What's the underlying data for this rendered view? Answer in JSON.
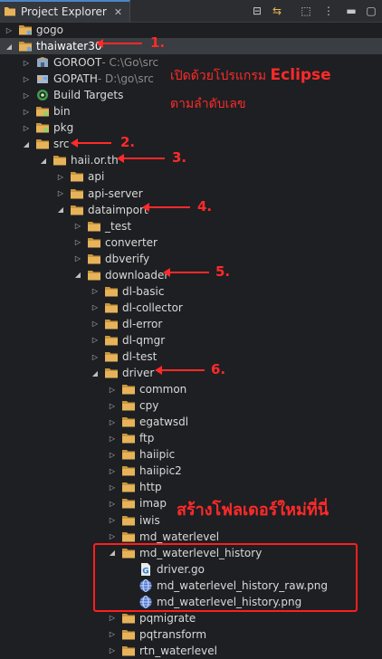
{
  "panel": {
    "tab_title": "Project Explorer",
    "close_glyph": "✕"
  },
  "toolbar": [
    {
      "name": "collapse-all-icon",
      "glyph": "⊟"
    },
    {
      "name": "link-with-editor-icon",
      "glyph": "⇆"
    },
    {
      "name": "focus-icon",
      "glyph": "⬚"
    },
    {
      "name": "view-menu-icon",
      "glyph": "⋮"
    },
    {
      "name": "minimize-icon",
      "glyph": "▬"
    },
    {
      "name": "maximize-icon",
      "glyph": "▢"
    }
  ],
  "tree": [
    {
      "label": "gogo",
      "depth": 0,
      "exp": false,
      "icon": "project-closed"
    },
    {
      "label": "thaiwater30",
      "depth": 0,
      "exp": true,
      "icon": "project",
      "sel": true
    },
    {
      "label": "GOROOT",
      "suffix": " - C:\\Go\\src",
      "depth": 1,
      "exp": false,
      "icon": "goroot"
    },
    {
      "label": "GOPATH",
      "suffix": " - D:\\go\\src",
      "depth": 1,
      "exp": false,
      "icon": "gopath"
    },
    {
      "label": "Build Targets",
      "depth": 1,
      "exp": false,
      "icon": "build"
    },
    {
      "label": "bin",
      "depth": 1,
      "exp": false,
      "icon": "folder-special"
    },
    {
      "label": "pkg",
      "depth": 1,
      "exp": false,
      "icon": "folder-special"
    },
    {
      "label": "src",
      "depth": 1,
      "exp": true,
      "icon": "folder"
    },
    {
      "label": "haii.or.th",
      "depth": 2,
      "exp": true,
      "icon": "folder"
    },
    {
      "label": "api",
      "depth": 3,
      "exp": false,
      "icon": "folder"
    },
    {
      "label": "api-server",
      "depth": 3,
      "exp": false,
      "icon": "folder"
    },
    {
      "label": "dataimport",
      "depth": 3,
      "exp": true,
      "icon": "folder"
    },
    {
      "label": "_test",
      "depth": 4,
      "exp": false,
      "icon": "folder"
    },
    {
      "label": "converter",
      "depth": 4,
      "exp": false,
      "icon": "folder"
    },
    {
      "label": "dbverify",
      "depth": 4,
      "exp": false,
      "icon": "folder"
    },
    {
      "label": "downloader",
      "depth": 4,
      "exp": true,
      "icon": "folder"
    },
    {
      "label": "dl-basic",
      "depth": 5,
      "exp": false,
      "icon": "folder"
    },
    {
      "label": "dl-collector",
      "depth": 5,
      "exp": false,
      "icon": "folder"
    },
    {
      "label": "dl-error",
      "depth": 5,
      "exp": false,
      "icon": "folder"
    },
    {
      "label": "dl-qmgr",
      "depth": 5,
      "exp": false,
      "icon": "folder"
    },
    {
      "label": "dl-test",
      "depth": 5,
      "exp": false,
      "icon": "folder"
    },
    {
      "label": "driver",
      "depth": 5,
      "exp": true,
      "icon": "folder"
    },
    {
      "label": "common",
      "depth": 6,
      "exp": false,
      "icon": "folder"
    },
    {
      "label": "cpy",
      "depth": 6,
      "exp": false,
      "icon": "folder"
    },
    {
      "label": "egatwsdl",
      "depth": 6,
      "exp": false,
      "icon": "folder"
    },
    {
      "label": "ftp",
      "depth": 6,
      "exp": false,
      "icon": "folder"
    },
    {
      "label": "haiipic",
      "depth": 6,
      "exp": false,
      "icon": "folder"
    },
    {
      "label": "haiipic2",
      "depth": 6,
      "exp": false,
      "icon": "folder"
    },
    {
      "label": "http",
      "depth": 6,
      "exp": false,
      "icon": "folder"
    },
    {
      "label": "imap",
      "depth": 6,
      "exp": false,
      "icon": "folder"
    },
    {
      "label": "iwis",
      "depth": 6,
      "exp": false,
      "icon": "folder"
    },
    {
      "label": "md_waterlevel",
      "depth": 6,
      "exp": false,
      "icon": "folder"
    },
    {
      "label": "md_waterlevel_history",
      "depth": 6,
      "exp": true,
      "icon": "folder"
    },
    {
      "label": "driver.go",
      "depth": 7,
      "leaf": true,
      "icon": "go-file"
    },
    {
      "label": "md_waterlevel_history_raw.png",
      "depth": 7,
      "leaf": true,
      "icon": "globe"
    },
    {
      "label": "md_waterlevel_history.png",
      "depth": 7,
      "leaf": true,
      "icon": "globe"
    },
    {
      "label": "pqmigrate",
      "depth": 6,
      "exp": false,
      "icon": "folder"
    },
    {
      "label": "pqtransform",
      "depth": 6,
      "exp": false,
      "icon": "folder"
    },
    {
      "label": "rtn_waterlevel",
      "depth": 6,
      "exp": false,
      "icon": "folder"
    }
  ],
  "annotations": {
    "note_line1_thai": "เปิดด้วยโปรแกรม",
    "note_line1_app": "Eclipse",
    "note_line2": "ตามลำดับเลข",
    "create_folder_note": "สร้างโฟลเดอร์ใหม่ที่นี่",
    "steps": [
      "1.",
      "2.",
      "3.",
      "4.",
      "5.",
      "6."
    ]
  },
  "colors": {
    "annotation_red": "#ff2a2a",
    "folder": "#e7b35a",
    "selection": "#3a3d41",
    "background": "#1e1f22"
  }
}
